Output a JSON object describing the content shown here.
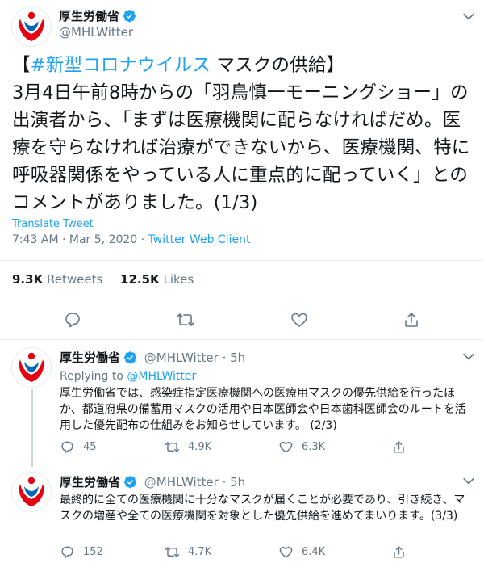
{
  "main_tweet": {
    "display_name": "厚生労働省",
    "handle": "@MHLWitter",
    "text_prefix": "【",
    "hashtag": "#新型コロナウイルス",
    "text_body": " マスクの供給】\n3月4日午前8時からの「羽鳥慎一モーニングショー」の出演者から、「まずは医療機関に配らなければだめ。医療を守らなければ治療ができないから、医療機関、特に呼吸器関係をやっている人に重点的に配っていく」とのコメントがありました。(1/3)",
    "translate_label": "Translate Tweet",
    "timestamp": "7:43 AM · Mar 5, 2020",
    "meta_sep": " · ",
    "client": "Twitter Web Client",
    "retweets_count": "9.3K",
    "retweets_label": "Retweets",
    "likes_count": "12.5K",
    "likes_label": "Likes"
  },
  "replies": [
    {
      "display_name": "厚生労働省",
      "handle_time": "@MHLWitter · 5h",
      "replying_label": "Replying to ",
      "replying_to": "@MHLWitter",
      "text": "厚生労働省では、感染症指定医療機関への医療用マスクの優先供給を行ったほか、都道府県の備蓄用マスクの活用や日本医師会や日本歯科医師会のルートを活用した優先配布の仕組みをお知らせしています。 (2/3)",
      "reply_count": "45",
      "retweet_count": "4.9K",
      "like_count": "6.3K"
    },
    {
      "display_name": "厚生労働省",
      "handle_time": "@MHLWitter · 5h",
      "text": "最終的に全ての医療機関に十分なマスクが届くことが必要であり、引き続き、マスクの増産や全ての医療機関を対象とした優先供給を進めてまいります。(3/3)",
      "reply_count": "152",
      "retweet_count": "4.7K",
      "like_count": "6.4K"
    }
  ],
  "colors": {
    "accent": "#1da1f2",
    "logo_red": "#e60012",
    "logo_blue": "#0068b7",
    "muted": "#657786"
  },
  "icons": [
    "avatar-logo",
    "verified-badge-icon",
    "chevron-down-icon",
    "reply-icon",
    "retweet-icon",
    "like-icon",
    "share-icon"
  ]
}
